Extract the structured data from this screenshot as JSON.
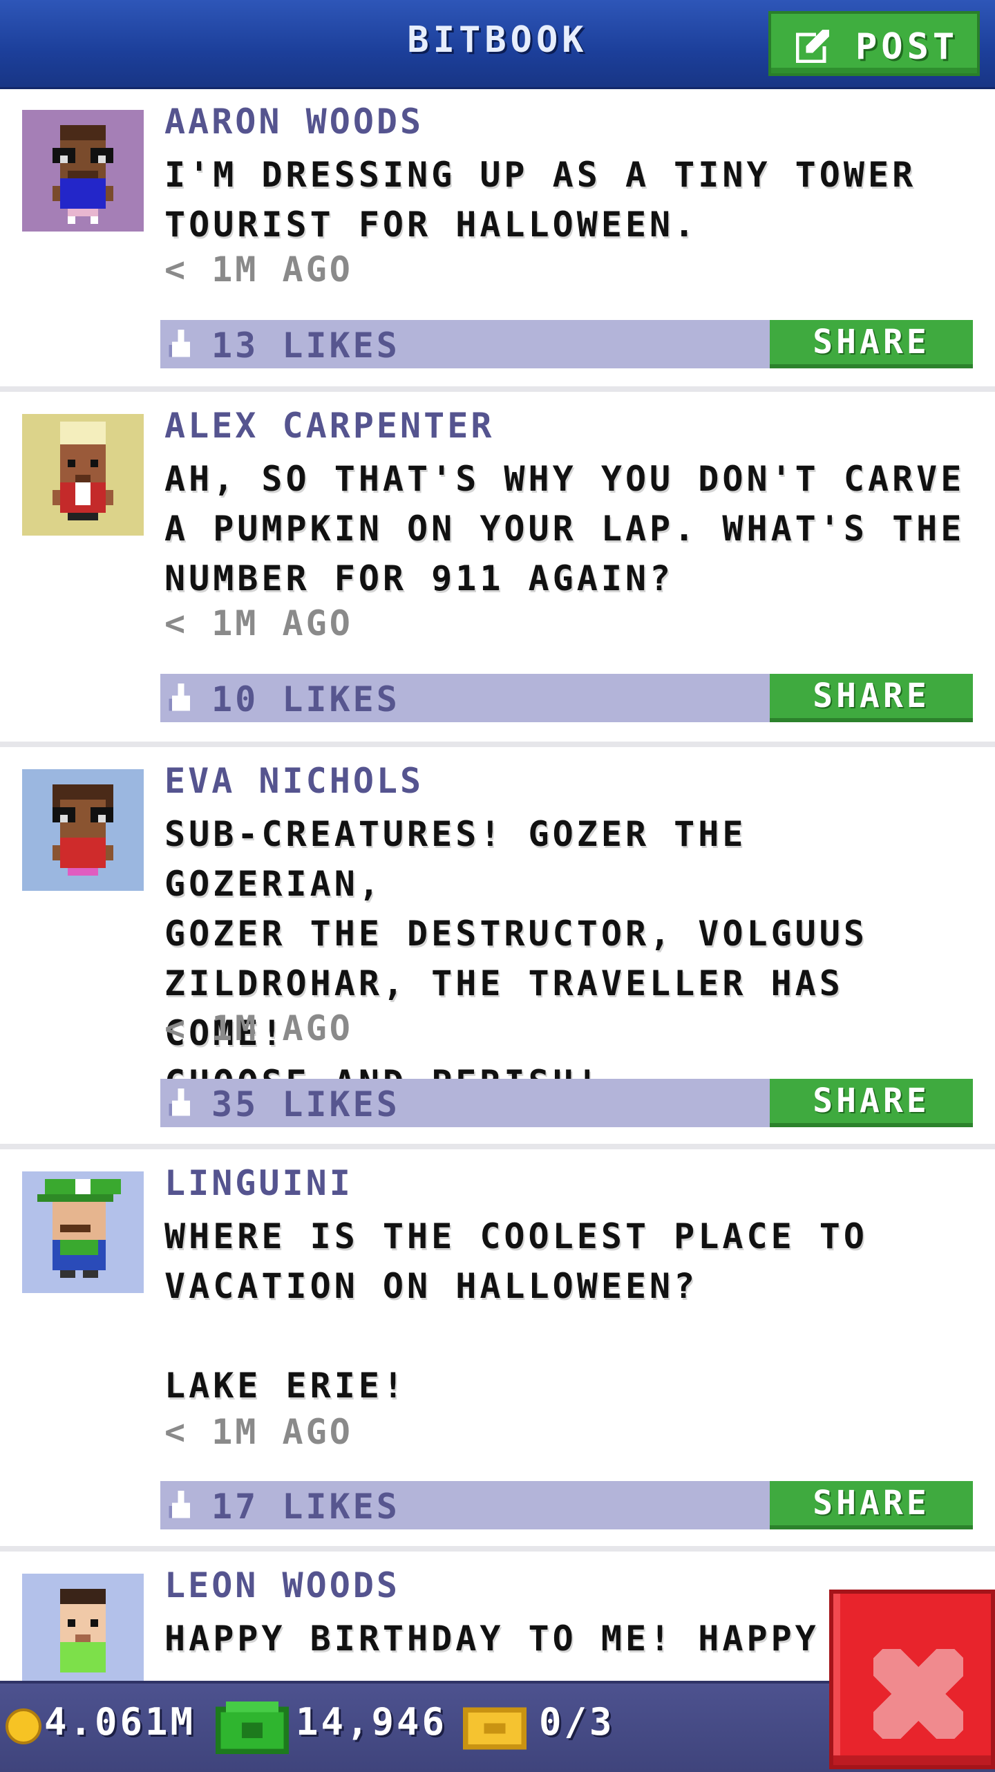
{
  "header": {
    "title": "BITBOOK",
    "post_label": "POST"
  },
  "posts": [
    {
      "author": "AARON WOODS",
      "body": "I'M DRESSING UP AS A TINY TOWER\nTOURIST FOR HALLOWEEN.",
      "time": "< 1M AGO",
      "likes": "13 LIKES",
      "share_label": "SHARE",
      "avatar_bg": "#a57fb6",
      "avatar_skin": "#7a4b2c",
      "avatar_shirt": "#2326c9"
    },
    {
      "author": "ALEX CARPENTER",
      "body": "AH, SO THAT'S WHY YOU DON'T CARVE\nA PUMPKIN ON YOUR LAP. WHAT'S THE\nNUMBER FOR 911 AGAIN?",
      "time": "< 1M AGO",
      "likes": "10 LIKES",
      "share_label": "SHARE",
      "avatar_bg": "#dcd38a",
      "avatar_skin": "#9a5a3a",
      "avatar_shirt": "#c42a2a"
    },
    {
      "author": "EVA NICHOLS",
      "body": "SUB-CREATURES! GOZER THE GOZERIAN,\nGOZER THE DESTRUCTOR, VOLGUUS\nZILDROHAR, THE TRAVELLER HAS COME!\nCHOOSE AND PERISH!",
      "time": "< 1M AGO",
      "likes": "35 LIKES",
      "share_label": "SHARE",
      "avatar_bg": "#9bb7e0",
      "avatar_skin": "#8a5431",
      "avatar_shirt": "#cf2b2b"
    },
    {
      "author": "LINGUINI",
      "body": "WHERE IS THE COOLEST PLACE TO\nVACATION ON HALLOWEEN?\n\nLAKE ERIE!",
      "time": "< 1M AGO",
      "likes": "17 LIKES",
      "share_label": "SHARE",
      "avatar_bg": "#b3c1ea",
      "avatar_skin": "#e6b58f",
      "avatar_shirt": "#2a4bb9"
    },
    {
      "author": "LEON WOODS",
      "body": "HAPPY BIRTHDAY TO ME! HAPPY",
      "time": "",
      "likes": "",
      "share_label": "",
      "avatar_bg": "#b3c1ea",
      "avatar_skin": "#f0c9a8",
      "avatar_shirt": "#7de04a"
    }
  ],
  "bottom_bar": {
    "coins": "4.061M",
    "bux": "14,946",
    "tickets": "0/3"
  },
  "colors": {
    "header_blue": "#1c3f9a",
    "post_green": "#3fae3f",
    "like_bar": "#b3b4d9",
    "author_text": "#55548f",
    "close_red": "#e8242c"
  },
  "icons": [
    "edit-icon",
    "like-icon",
    "coin-icon",
    "bux-icon",
    "ticket-icon",
    "close-icon"
  ]
}
